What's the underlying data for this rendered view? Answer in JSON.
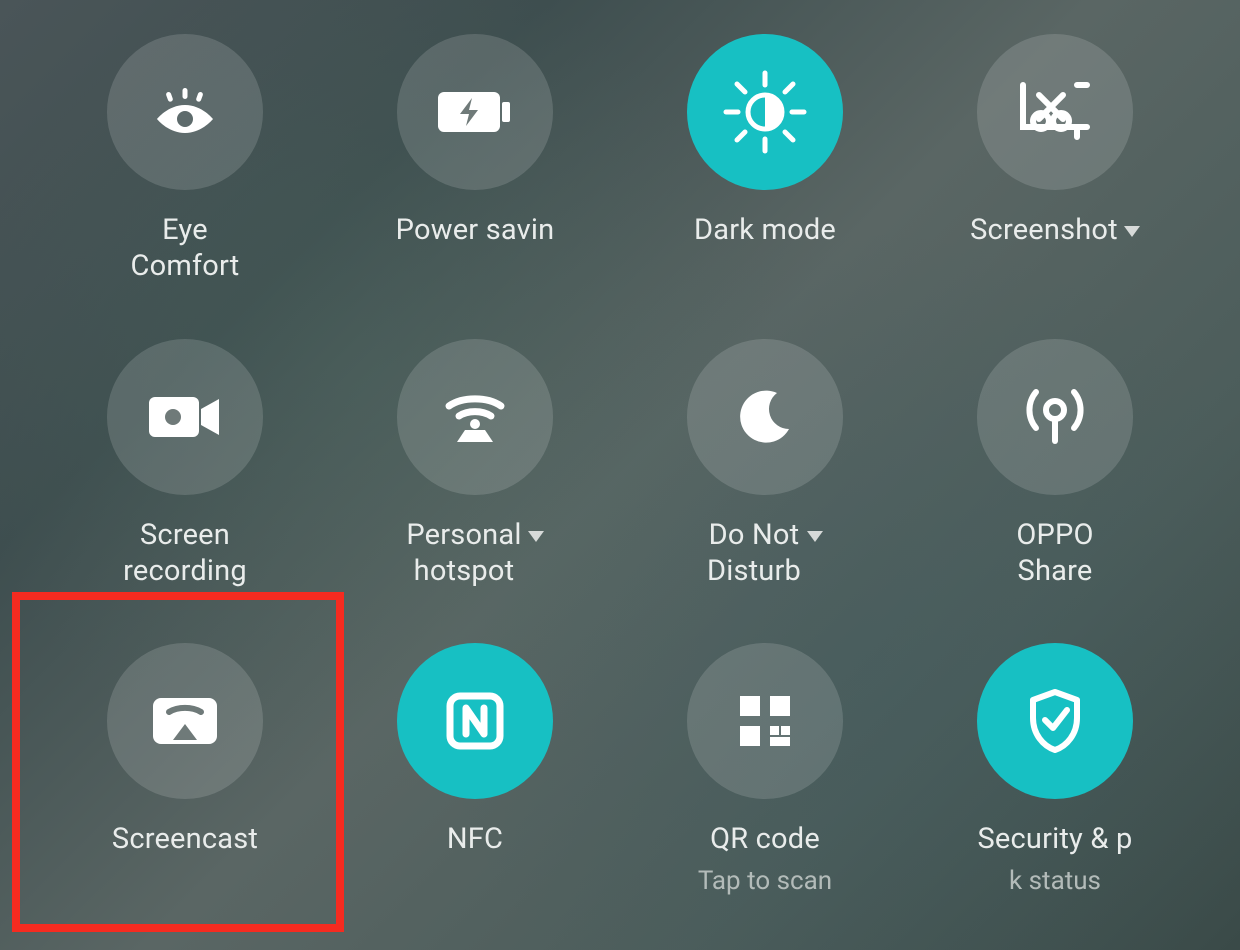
{
  "highlight": {
    "target": "screencast"
  },
  "tiles": [
    {
      "id": "eye-comfort",
      "label": "Eye\nComfort",
      "sublabel": "",
      "active": false,
      "icon": "eye-icon",
      "dropdown": false
    },
    {
      "id": "power-saving",
      "label": "Power savin",
      "sublabel": "",
      "active": false,
      "icon": "battery-charge-icon",
      "dropdown": false,
      "clipped": true
    },
    {
      "id": "dark-mode",
      "label": "Dark mode",
      "sublabel": "",
      "active": true,
      "icon": "brightness-icon",
      "dropdown": false
    },
    {
      "id": "screenshot",
      "label": "Screenshot",
      "sublabel": "",
      "active": false,
      "icon": "scissors-crop-icon",
      "dropdown": true
    },
    {
      "id": "screen-record",
      "label": "Screen\nrecording",
      "sublabel": "",
      "active": false,
      "icon": "video-camera-icon",
      "dropdown": false
    },
    {
      "id": "personal-hotspot",
      "label": "Personal\nhotspot",
      "sublabel": "",
      "active": false,
      "icon": "hotspot-icon",
      "dropdown": true
    },
    {
      "id": "do-not-disturb",
      "label": "Do Not\nDisturb",
      "sublabel": "",
      "active": false,
      "icon": "moon-icon",
      "dropdown": true
    },
    {
      "id": "oppo-share",
      "label": "OPPO\nShare",
      "sublabel": "",
      "active": false,
      "icon": "antenna-icon",
      "dropdown": false
    },
    {
      "id": "screencast",
      "label": "Screencast",
      "sublabel": "",
      "active": false,
      "icon": "screencast-icon",
      "dropdown": false
    },
    {
      "id": "nfc",
      "label": "NFC",
      "sublabel": "",
      "active": true,
      "icon": "nfc-icon",
      "dropdown": false
    },
    {
      "id": "qr-code",
      "label": "QR code",
      "sublabel": "Tap to scan",
      "active": false,
      "icon": "qr-code-icon",
      "dropdown": false
    },
    {
      "id": "security",
      "label": "Security & p",
      "sublabel": "k status",
      "active": true,
      "icon": "shield-icon",
      "dropdown": false,
      "clipped": true
    }
  ]
}
